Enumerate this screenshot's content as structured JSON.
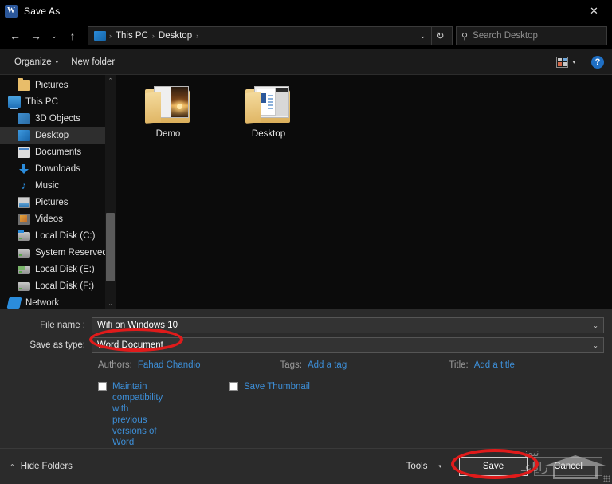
{
  "titlebar": {
    "app_icon": "word-icon",
    "title": "Save As",
    "close_label": "✕"
  },
  "navbar": {
    "back": "←",
    "forward": "→",
    "recent": "⌄",
    "up": "↑",
    "breadcrumb": {
      "icon": "desktop-icon",
      "items": [
        "This PC",
        "Desktop"
      ],
      "separator": "›",
      "trailing_separator": "›"
    },
    "history_chevron": "⌄",
    "refresh": "↻",
    "search": {
      "icon": "search-icon",
      "placeholder": "Search Desktop",
      "value": ""
    }
  },
  "toolbar": {
    "organize_label": "Organize",
    "organize_caret": "▾",
    "new_folder_label": "New folder",
    "view_icon": "view-layout-icon",
    "view_caret": "▾",
    "help_label": "?"
  },
  "sidebar": {
    "scroll_up": "⌃",
    "scroll_down": "⌄",
    "items": [
      {
        "label": "Pictures",
        "icon": "folder-icon",
        "indent": 2,
        "selected": false
      },
      {
        "label": "This PC",
        "icon": "pc-icon",
        "indent": 1,
        "selected": false
      },
      {
        "label": "3D Objects",
        "icon": "3d-icon",
        "indent": 2,
        "selected": false
      },
      {
        "label": "Desktop",
        "icon": "desktop-icon",
        "indent": 2,
        "selected": true
      },
      {
        "label": "Documents",
        "icon": "documents-icon",
        "indent": 2,
        "selected": false
      },
      {
        "label": "Downloads",
        "icon": "download-icon",
        "indent": 2,
        "selected": false
      },
      {
        "label": "Music",
        "icon": "music-icon",
        "indent": 2,
        "selected": false
      },
      {
        "label": "Pictures",
        "icon": "pictures-icon",
        "indent": 2,
        "selected": false
      },
      {
        "label": "Videos",
        "icon": "videos-icon",
        "indent": 2,
        "selected": false
      },
      {
        "label": "Local Disk (C:)",
        "icon": "drive-icon",
        "indent": 2,
        "selected": false
      },
      {
        "label": "System Reserved",
        "icon": "drive-icon",
        "indent": 2,
        "selected": false
      },
      {
        "label": "Local Disk (E:)",
        "icon": "drive-icon",
        "indent": 2,
        "selected": false
      },
      {
        "label": "Local Disk (F:)",
        "icon": "drive-icon",
        "indent": 2,
        "selected": false
      },
      {
        "label": "Network",
        "icon": "network-icon",
        "indent": 1,
        "selected": false
      }
    ]
  },
  "filepane": {
    "items": [
      {
        "label": "Demo",
        "icon": "folder-icon",
        "thumbnail": "sunset-photo"
      },
      {
        "label": "Desktop",
        "icon": "folder-icon",
        "thumbnail": "word-document"
      }
    ]
  },
  "form": {
    "filename_label": "File name :",
    "filename_value": "Wifi on Windows 10",
    "filename_chevron": "⌄",
    "filetype_label": "Save as type:",
    "filetype_value": "Word Document",
    "filetype_chevron": "⌄",
    "authors_label": "Authors:",
    "authors_value": "Fahad Chandio",
    "tags_label": "Tags:",
    "tags_value": "Add a tag",
    "title_label": "Title:",
    "title_value": "Add a title",
    "maintain_compat_label": "Maintain compatibility with previous versions of Word",
    "maintain_compat_checked": false,
    "save_thumbnail_label": "Save Thumbnail",
    "save_thumbnail_checked": false
  },
  "footer": {
    "hide_folders_caret": "⌃",
    "hide_folders_label": "Hide Folders",
    "tools_label": "Tools",
    "tools_caret": "▾",
    "save_label": "Save",
    "cancel_label": "Cancel"
  },
  "watermark": {
    "line1": "نیوز",
    "line2": "رایاعـ"
  },
  "annotations": {
    "color": "#e01b1b",
    "targets": [
      "filename-field",
      "save-button"
    ]
  }
}
